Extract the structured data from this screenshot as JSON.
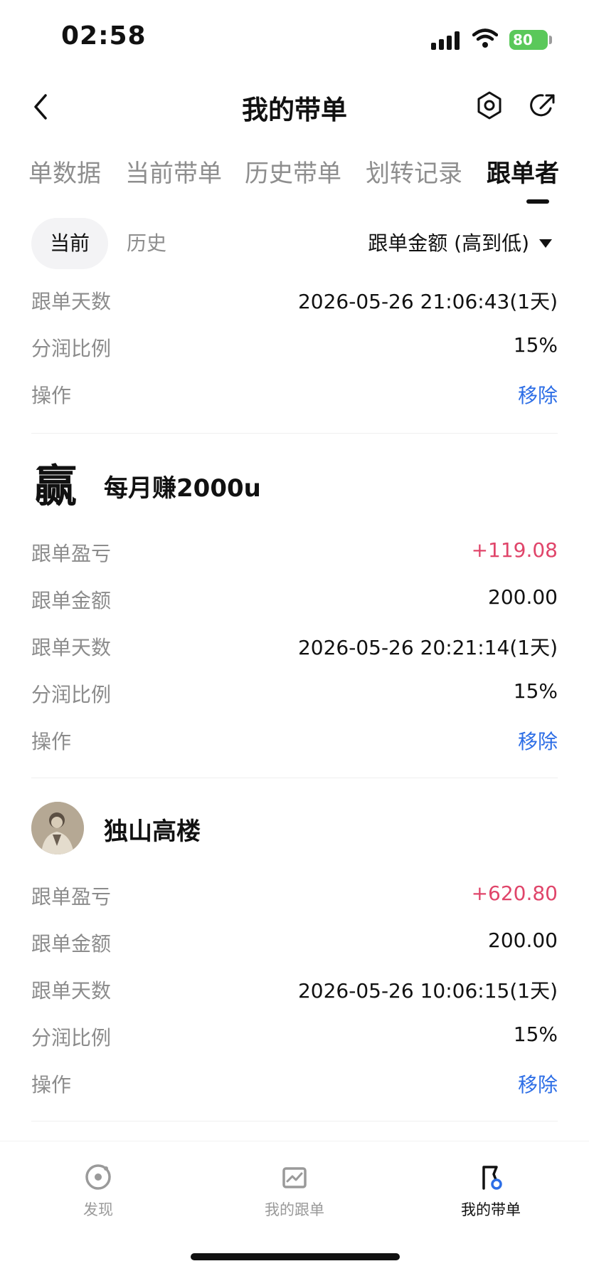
{
  "status_bar": {
    "time": "02:58",
    "battery": "80"
  },
  "header": {
    "title": "我的带单",
    "back_icon": "chevron-left-icon",
    "settings_icon": "hexagon-settings-icon",
    "share_icon": "share-icon"
  },
  "tabs": [
    {
      "label": "单数据"
    },
    {
      "label": "当前带单"
    },
    {
      "label": "历史带单"
    },
    {
      "label": "划转记录"
    },
    {
      "label": "跟单者",
      "active": true
    }
  ],
  "filters": {
    "current": "当前",
    "history": "历史",
    "sort": "跟单金额 (高到低)"
  },
  "first_partial": {
    "days_label": "跟单天数",
    "days_value": "2026-05-26 21:06:43(1天)",
    "ratio_label": "分润比例",
    "ratio_value": "15%",
    "action_label": "操作",
    "action_value": "移除"
  },
  "followers": [
    {
      "name": "每月赚2000u",
      "avatar_text": "赢",
      "pnl_label": "跟单盈亏",
      "pnl_value": "+119.08",
      "amount_label": "跟单金额",
      "amount_value": "200.00",
      "days_label": "跟单天数",
      "days_value": "2026-05-26 20:21:14(1天)",
      "ratio_label": "分润比例",
      "ratio_value": "15%",
      "action_label": "操作",
      "action_value": "移除"
    },
    {
      "name": "独山高楼",
      "pnl_label": "跟单盈亏",
      "pnl_value": "+620.80",
      "amount_label": "跟单金额",
      "amount_value": "200.00",
      "days_label": "跟单天数",
      "days_value": "2026-05-26 10:06:15(1天)",
      "ratio_label": "分润比例",
      "ratio_value": "15%",
      "action_label": "操作",
      "action_value": "移除"
    }
  ],
  "bottom_nav": [
    {
      "label": "发现"
    },
    {
      "label": "我的跟单"
    },
    {
      "label": "我的带单",
      "active": true
    }
  ],
  "colors": {
    "profit": "#e0456a",
    "action": "#2d6ee6",
    "battery": "#5ac85a"
  }
}
